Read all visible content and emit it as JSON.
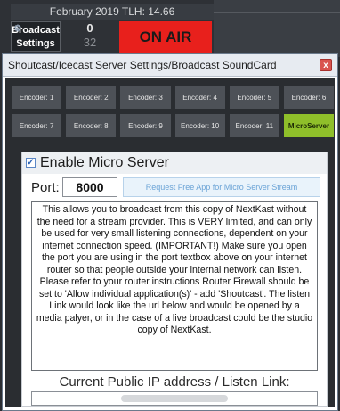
{
  "app": {
    "tlh_text": "February 2019 TLH: 14.66",
    "broadcast_button": "Broadcast Settings",
    "count_top": "0",
    "count_bottom": "32",
    "on_air_label": "ON AIR"
  },
  "dialog": {
    "title": "Shoutcast/Icecast Server Settings/Broadcast SoundCard",
    "close_label": "x",
    "encoder_row1": [
      "Encoder: 1",
      "Encoder: 2",
      "Encoder: 3",
      "Encoder: 4",
      "Encoder: 5",
      "Encoder: 6"
    ],
    "encoder_row2": [
      "Encoder: 7",
      "Encoder: 8",
      "Encoder: 9",
      "Encoder: 10",
      "Encoder: 11",
      "MicroServer"
    ],
    "active_tab": "MicroServer",
    "enable_label": "Enable Micro Server",
    "enable_checked": true,
    "port_label": "Port:",
    "port_value": "8000",
    "request_button": "Request Free App for Micro Server Stream",
    "info_text": "This allows you to broadcast from this copy of NextKast without the need for a stream provider. This is VERY limited, and can only be used for very small listening connections, dependent on your internet connection speed. (IMPORTANT!) Make sure you open the port you are using in the port textbox above on your internet router so that people outside your internal network can listen. Please refer to your router instructions Router Firewall should be set to 'Allow individual application(s)' - add 'Shoutcast'. The listen Link would look like the url below and would be opened by a media palyer, or in the case of a live broadcast could be the studio copy of NextKast.",
    "ip_label": "Current Public IP address / Listen Link:"
  },
  "colors": {
    "on_air": "#e8201c",
    "active_tab": "#8fbf2a",
    "tab": "#4d5157",
    "panel_bg": "#2a2d31"
  }
}
